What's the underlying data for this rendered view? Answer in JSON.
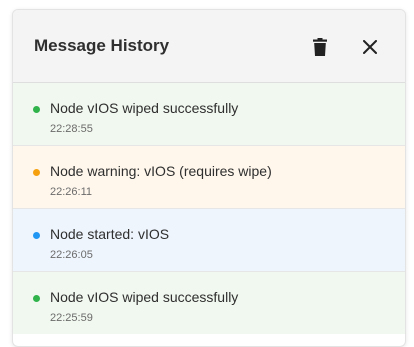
{
  "header": {
    "title": "Message History"
  },
  "colors": {
    "success_dot": "#2fb34a",
    "warning_dot": "#f5a00f",
    "info_dot": "#2196f3",
    "success_bg": "#f1f8ef",
    "warning_bg": "#fff7ec",
    "info_bg": "#eef5fd"
  },
  "icons": {
    "clear": "trash-icon",
    "close": "close-icon"
  },
  "messages": [
    {
      "status": "success",
      "text": "Node vIOS wiped successfully",
      "time": "22:28:55"
    },
    {
      "status": "warning",
      "text": "Node warning: vIOS (requires wipe)",
      "time": "22:26:11"
    },
    {
      "status": "info",
      "text": "Node started: vIOS",
      "time": "22:26:05"
    },
    {
      "status": "success",
      "text": "Node vIOS wiped successfully",
      "time": "22:25:59"
    }
  ]
}
